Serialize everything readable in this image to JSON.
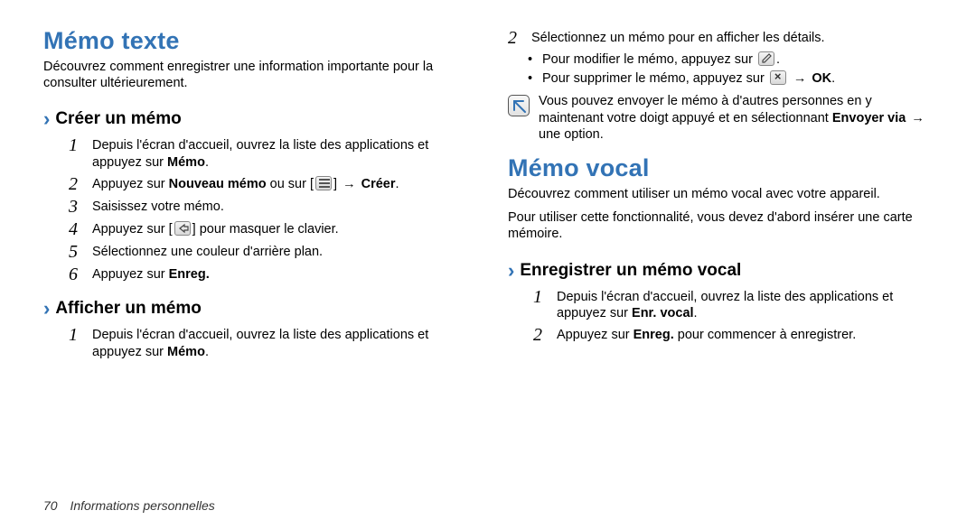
{
  "col1": {
    "title": "Mémo texte",
    "intro": "Découvrez comment enregistrer une information importante pour la consulter ultérieurement.",
    "sec1": {
      "title": "Créer un mémo",
      "s1a": "Depuis l'écran d'accueil, ouvrez la liste des applications et appuyez sur ",
      "s1b": "Mémo",
      "s1c": ".",
      "s2a": "Appuyez sur ",
      "s2b": "Nouveau mémo",
      "s2c": " ou sur [",
      "s2d": "] ",
      "s2e": " ",
      "s2f": "Créer",
      "s2g": ".",
      "s3": "Saisissez votre mémo.",
      "s4a": "Appuyez sur [",
      "s4b": "] pour masquer le clavier.",
      "s5": "Sélectionnez une couleur d'arrière plan.",
      "s6a": "Appuyez sur ",
      "s6b": "Enreg."
    },
    "sec2": {
      "title": "Afficher un mémo",
      "s1a": "Depuis l'écran d'accueil, ouvrez la liste des applications et appuyez sur ",
      "s1b": "Mémo",
      "s1c": "."
    }
  },
  "col2": {
    "top": {
      "s2": "Sélectionnez un mémo pour en afficher les détails.",
      "b1a": "Pour modifier le mémo, appuyez sur ",
      "b1b": ".",
      "b2a": "Pour supprimer le mémo, appuyez sur ",
      "b2b": " ",
      "b2c": " ",
      "b2d": "OK",
      "b2e": ".",
      "note_a": "Vous pouvez envoyer le mémo à d'autres personnes en y maintenant votre doigt appuyé et en sélectionnant ",
      "note_b": "Envoyer via",
      "note_c": " ",
      "note_d": " une option."
    },
    "vocal": {
      "title": "Mémo vocal",
      "intro": "Découvrez comment utiliser un mémo vocal avec votre appareil.",
      "intro2": "Pour utiliser cette fonctionnalité, vous devez d'abord insérer une carte mémoire.",
      "sec1": {
        "title": "Enregistrer un mémo vocal",
        "s1a": "Depuis l'écran d'accueil, ouvrez la liste des applications et appuyez sur ",
        "s1b": "Enr. vocal",
        "s1c": ".",
        "s2a": "Appuyez sur ",
        "s2b": "Enreg.",
        "s2c": " pour commencer à enregistrer."
      }
    }
  },
  "footer": {
    "page": "70",
    "section": "Informations personnelles"
  },
  "glyphs": {
    "arrow": "→"
  }
}
